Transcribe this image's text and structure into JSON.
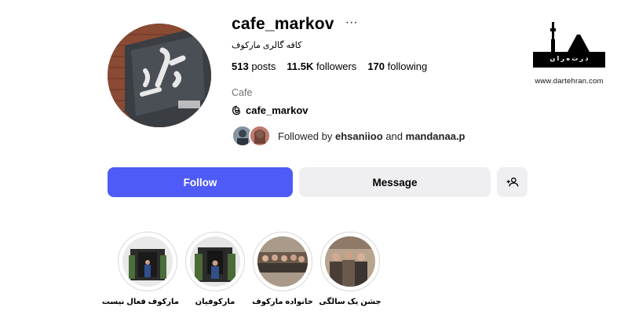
{
  "profile": {
    "username": "cafe_markov",
    "full_name": "کافه گالری مارکوف",
    "category": "Cafe",
    "threads_handle": "cafe_markov"
  },
  "stats": {
    "posts_count": "513",
    "posts_label": "posts",
    "followers_count": "11.5K",
    "followers_label": "followers",
    "following_count": "170",
    "following_label": "following"
  },
  "followed_by": {
    "prefix": "Followed by",
    "user1": "ehsaniioo",
    "connector": "and",
    "user2": "mandanaa.p"
  },
  "actions": {
    "follow_label": "Follow",
    "message_label": "Message"
  },
  "highlights": [
    {
      "label": "مارکوف فعال نیست"
    },
    {
      "label": "مارکوفیان"
    },
    {
      "label": "خانواده مارکوف"
    },
    {
      "label": "جشن یک سالگی"
    }
  ],
  "icons": {
    "more": "more-horizontal-icon",
    "threads": "threads-icon",
    "add_user": "add-user-icon"
  },
  "colors": {
    "follow_button": "#4f5bf6",
    "secondary_button": "#efeff2",
    "muted_text": "#737373"
  },
  "watermark": {
    "logo_text": "د ر ت ه ر ا ن",
    "url": "www.dartehran.com"
  }
}
